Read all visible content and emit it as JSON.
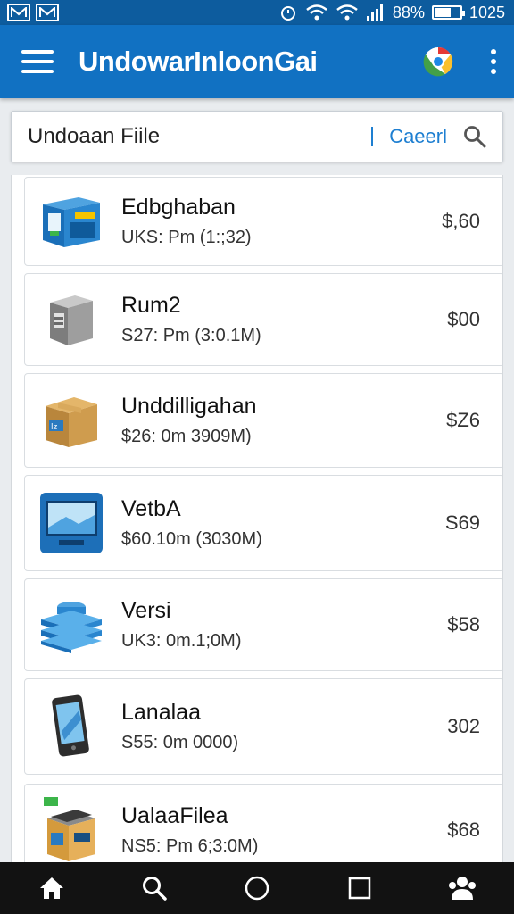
{
  "status_bar": {
    "signal_text": "88%",
    "time": "1025"
  },
  "app_bar": {
    "title": "UndowarInloonGai"
  },
  "search": {
    "value": "Undoaan Fiile",
    "cancel_label": "Caeerl"
  },
  "items": [
    {
      "name": "Edbghaban",
      "meta": "UKS: Pm (1:;32)",
      "price": "$,60",
      "icon": "blue-box-icon"
    },
    {
      "name": "Rum2",
      "meta": "S27: Pm (3:0.1M)",
      "price": "$00",
      "icon": "gray-box-icon"
    },
    {
      "name": "Unddilligahan",
      "meta": "$26: 0m 3909M)",
      "price": "$Z6",
      "icon": "cardboard-box-icon"
    },
    {
      "name": "VetbA",
      "meta": "$60.10m (3030M)",
      "price": "S69",
      "icon": "monitor-icon"
    },
    {
      "name": "Versi",
      "meta": "UK3: 0m.1;0M)",
      "price": "$58",
      "icon": "stacked-layers-icon"
    },
    {
      "name": "Lanalaa",
      "meta": "S55: 0m 0000)",
      "price": "302",
      "icon": "phone-icon"
    },
    {
      "name": "UalaaFilea",
      "meta": "NS5: Pm 6;3:0M)",
      "price": "$68",
      "icon": "package-icon"
    }
  ],
  "colors": {
    "app_bar": "#1171c2",
    "status_bar": "#0d5c9e",
    "accent": "#1e7fd1",
    "bottom_nav": "#121212"
  }
}
